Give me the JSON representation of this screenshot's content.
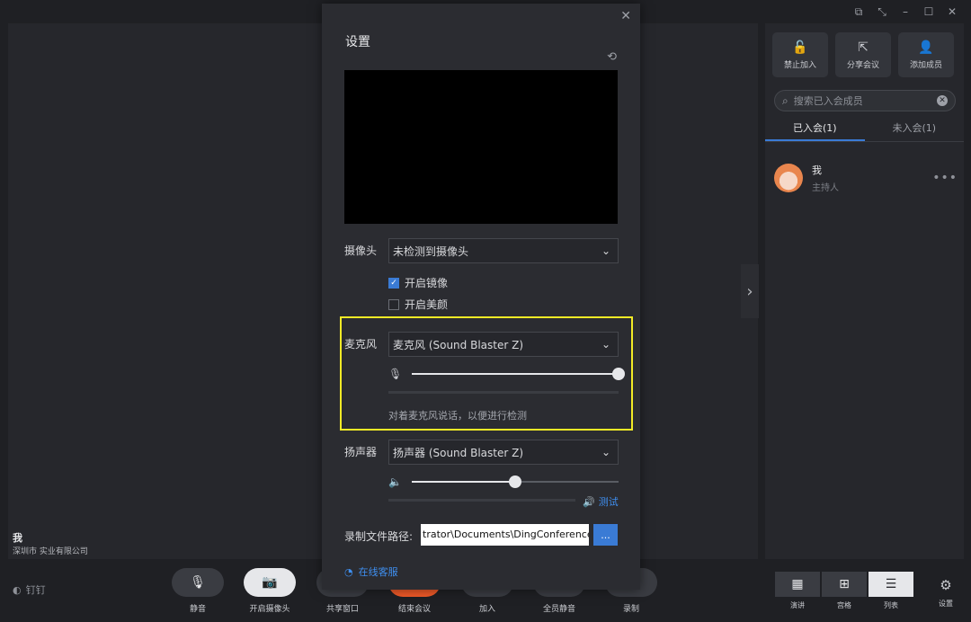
{
  "window": {
    "controls": [
      "⧉",
      "⤡",
      "–",
      "☐",
      "✕"
    ]
  },
  "video": {
    "self_name": "我",
    "self_org": "深圳市    实业有限公司",
    "expand_chevron": "›"
  },
  "right_panel": {
    "actions": [
      {
        "icon": "lock-icon",
        "glyph": "🔓",
        "label": "禁止加入"
      },
      {
        "icon": "share-icon",
        "glyph": "⇱",
        "label": "分享会议"
      },
      {
        "icon": "add-user-icon",
        "glyph": "👤",
        "label": "添加成员"
      }
    ],
    "search_placeholder": "搜索已入会成员",
    "tabs": [
      {
        "label": "已入会(1)",
        "active": true
      },
      {
        "label": "未入会(1)",
        "active": false
      }
    ],
    "members": [
      {
        "name": "我",
        "role": "主持人"
      }
    ]
  },
  "toolbar": {
    "pin_label": "钉钉",
    "buttons": [
      {
        "name": "mute",
        "glyph": "🎙",
        "label": "静音",
        "style": ""
      },
      {
        "name": "camera",
        "glyph": "📷",
        "label": "开启摄像头",
        "style": "light"
      },
      {
        "name": "share",
        "glyph": "⧉",
        "label": "共享窗口",
        "style": ""
      },
      {
        "name": "end",
        "glyph": "",
        "label": "结束会议",
        "style": "red"
      },
      {
        "name": "join",
        "glyph": "＋",
        "label": "加入",
        "style": ""
      },
      {
        "name": "mute-all",
        "glyph": "🔇",
        "label": "全员静音",
        "style": ""
      },
      {
        "name": "record",
        "glyph": "⏺",
        "label": "录制",
        "style": ""
      }
    ],
    "views": [
      {
        "glyph": "▦",
        "label": "演讲",
        "active": false
      },
      {
        "glyph": "⊞",
        "label": "宫格",
        "active": false
      },
      {
        "glyph": "☰",
        "label": "列表",
        "active": true
      }
    ],
    "settings_label": "设置"
  },
  "dialog": {
    "title": "设置",
    "camera_label": "摄像头",
    "camera_value": "未检测到摄像头",
    "mirror_label": "开启镜像",
    "mirror_checked": true,
    "beauty_label": "开启美颜",
    "beauty_checked": false,
    "mic_label": "麦克风",
    "mic_value": "麦克风 (Sound Blaster Z)",
    "mic_volume": 1.0,
    "mic_hint": "对着麦克风说话，以便进行检测",
    "speaker_label": "扬声器",
    "speaker_value": "扬声器 (Sound Blaster Z)",
    "speaker_volume": 0.5,
    "test_label": "测试",
    "record_path_label": "录制文件路径:",
    "record_path_value": "trator\\Documents\\DingConference",
    "browse_label": "...",
    "service_label": "在线客服"
  },
  "colors": {
    "accent": "#3a7bd5",
    "end_call": "#f05a28",
    "highlight": "#f2ea26"
  }
}
